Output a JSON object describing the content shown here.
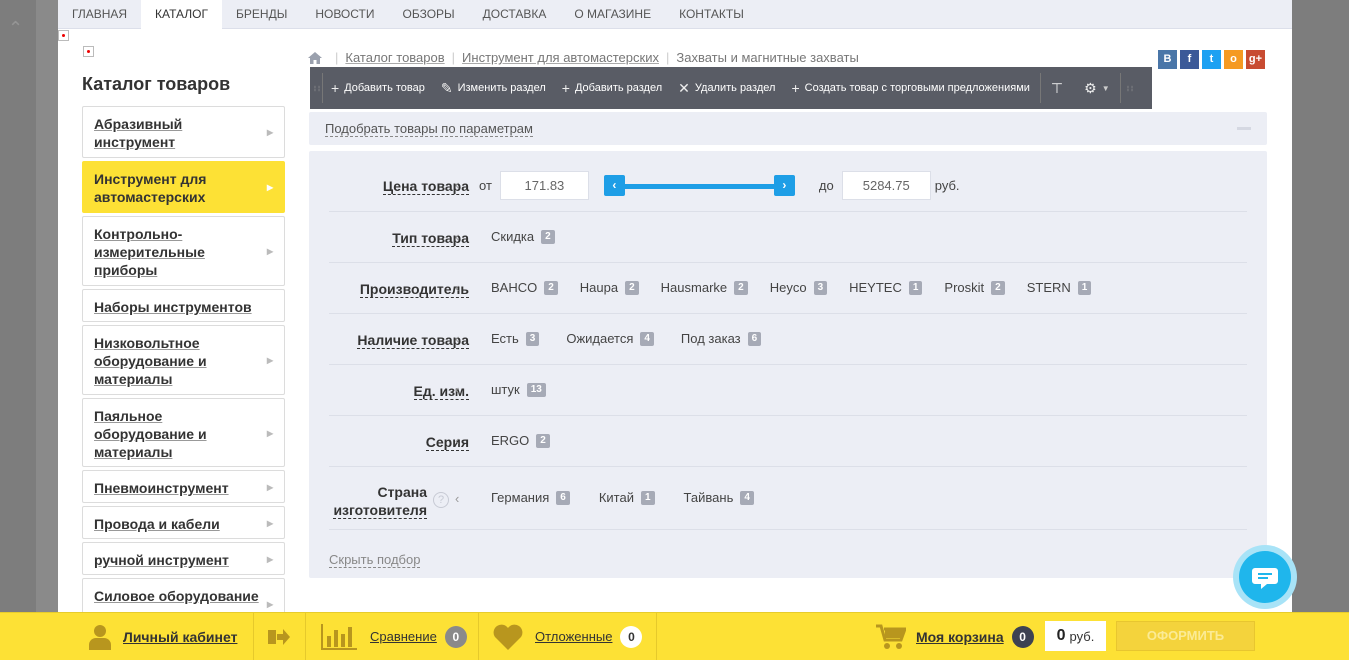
{
  "nav": {
    "items": [
      {
        "label": "ГЛАВНАЯ"
      },
      {
        "label": "КАТАЛОГ"
      },
      {
        "label": "БРЕНДЫ"
      },
      {
        "label": "НОВОСТИ"
      },
      {
        "label": "ОБЗОРЫ"
      },
      {
        "label": "ДОСТАВКА"
      },
      {
        "label": "О МАГАЗИНЕ"
      },
      {
        "label": "КОНТАКТЫ"
      }
    ]
  },
  "catalog": {
    "title": "Каталог товаров",
    "items": [
      {
        "label": "Абразивный инструмент"
      },
      {
        "label": "Инструмент для автомастерских"
      },
      {
        "label": "Контрольно-измерительные приборы"
      },
      {
        "label": "Наборы инструментов"
      },
      {
        "label": "Низковольтное оборудование и материалы"
      },
      {
        "label": "Паяльное оборудование и материалы"
      },
      {
        "label": "Пневмоинструмент"
      },
      {
        "label": "Провода и кабели"
      },
      {
        "label": "ручной инструмент"
      },
      {
        "label": "Силовое оборудование"
      }
    ]
  },
  "breadcrumb": {
    "items": [
      {
        "label": "Каталог товаров"
      },
      {
        "label": "Инструмент для автомастерских"
      },
      {
        "label": "Захваты и магнитные захваты"
      }
    ]
  },
  "social": {
    "vk": "B",
    "fb": "f",
    "tw": "t",
    "ok": "o",
    "gp": "g+"
  },
  "admin_bar": {
    "add_product": "Добавить товар",
    "edit_section": "Изменить раздел",
    "add_section": "Добавить раздел",
    "delete_section": "Удалить раздел",
    "create_product_offers": "Создать товар с торговыми предложениями"
  },
  "filter": {
    "header": "Подобрать товары по параметрам",
    "hide_label": "Скрыть подбор",
    "price": {
      "label": "Цена товара",
      "from_label": "от",
      "to_label": "до",
      "from_value": "171.83",
      "to_value": "5284.75",
      "currency": "руб."
    },
    "type": {
      "label": "Тип товара",
      "options": [
        {
          "name": "Скидка",
          "count": "2"
        }
      ]
    },
    "manufacturer": {
      "label": "Производитель",
      "options": [
        {
          "name": "BAHCO",
          "count": "2"
        },
        {
          "name": "Haupa",
          "count": "2"
        },
        {
          "name": "Hausmarke",
          "count": "2"
        },
        {
          "name": "Heyco",
          "count": "3"
        },
        {
          "name": "HEYTEC",
          "count": "1"
        },
        {
          "name": "Proskit",
          "count": "2"
        },
        {
          "name": "STERN",
          "count": "1"
        }
      ]
    },
    "availability": {
      "label": "Наличие товара",
      "options": [
        {
          "name": "Есть",
          "count": "3"
        },
        {
          "name": "Ожидается",
          "count": "4"
        },
        {
          "name": "Под заказ",
          "count": "6"
        }
      ]
    },
    "unit": {
      "label": "Ед. изм.",
      "options": [
        {
          "name": "штук",
          "count": "13"
        }
      ]
    },
    "series": {
      "label": "Серия",
      "options": [
        {
          "name": "ERGO",
          "count": "2"
        }
      ]
    },
    "country": {
      "label_line1": "Страна",
      "label_line2": "изготовителя",
      "help": "?",
      "options": [
        {
          "name": "Германия",
          "count": "6"
        },
        {
          "name": "Китай",
          "count": "1"
        },
        {
          "name": "Тайвань",
          "count": "4"
        }
      ]
    }
  },
  "bottom_bar": {
    "account": "Личный кабинет",
    "compare": "Сравнение",
    "compare_count": "0",
    "wishlist": "Отложенные",
    "wishlist_count": "0",
    "cart": "Моя корзина",
    "cart_count": "0",
    "cart_sum": "0",
    "cart_currency": "руб.",
    "checkout": "ОФОРМИТЬ"
  },
  "colors": {
    "accent_yellow": "#fde135",
    "slider_blue": "#1e9ee6",
    "chat_blue": "#1fb6ec",
    "admin_bar": "#595c65"
  }
}
